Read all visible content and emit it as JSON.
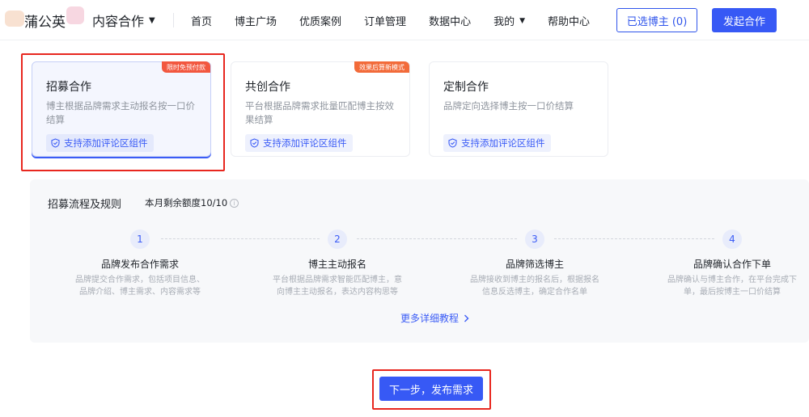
{
  "header": {
    "logo_text": "蒲公英",
    "product_menu": "内容合作",
    "nav": [
      "首页",
      "博主广场",
      "优质案例",
      "订单管理",
      "数据中心",
      "我的",
      "帮助中心"
    ],
    "selected_bloggers_button": "已选博主 (0)",
    "launch_button": "发起合作"
  },
  "cards": [
    {
      "title": "招募合作",
      "badge": "限时免预付款",
      "desc": "博主根据品牌需求主动报名按一口价结算",
      "tag": "支持添加评论区组件"
    },
    {
      "title": "共创合作",
      "badge": "效果后算新模式",
      "desc": "平台根据品牌需求批量匹配博主按效果结算",
      "tag": "支持添加评论区组件"
    },
    {
      "title": "定制合作",
      "desc": "品牌定向选择博主按一口价结算",
      "tag": "支持添加评论区组件"
    }
  ],
  "process": {
    "title": "招募流程及规则",
    "quota": "本月剩余额度10/10",
    "steps": [
      {
        "num": "1",
        "title": "品牌发布合作需求",
        "desc": "品牌提交合作需求，包括项目信息、品牌介绍、博主需求、内容需求等"
      },
      {
        "num": "2",
        "title": "博主主动报名",
        "desc": "平台根据品牌需求智能匹配博主，意向博主主动报名，表达内容构思等"
      },
      {
        "num": "3",
        "title": "品牌筛选博主",
        "desc": "品牌接收到博主的报名后，根据报名信息反选博主，确定合作名单"
      },
      {
        "num": "4",
        "title": "品牌确认合作下单",
        "desc": "品牌确认与博主合作，在平台完成下单，最后按博主一口价结算"
      }
    ],
    "more_link": "更多详细教程"
  },
  "next_button": "下一步，发布需求",
  "colors": {
    "accent": "#3759f5",
    "highlight_frame": "#e8271f",
    "badge": "#f2573f"
  }
}
